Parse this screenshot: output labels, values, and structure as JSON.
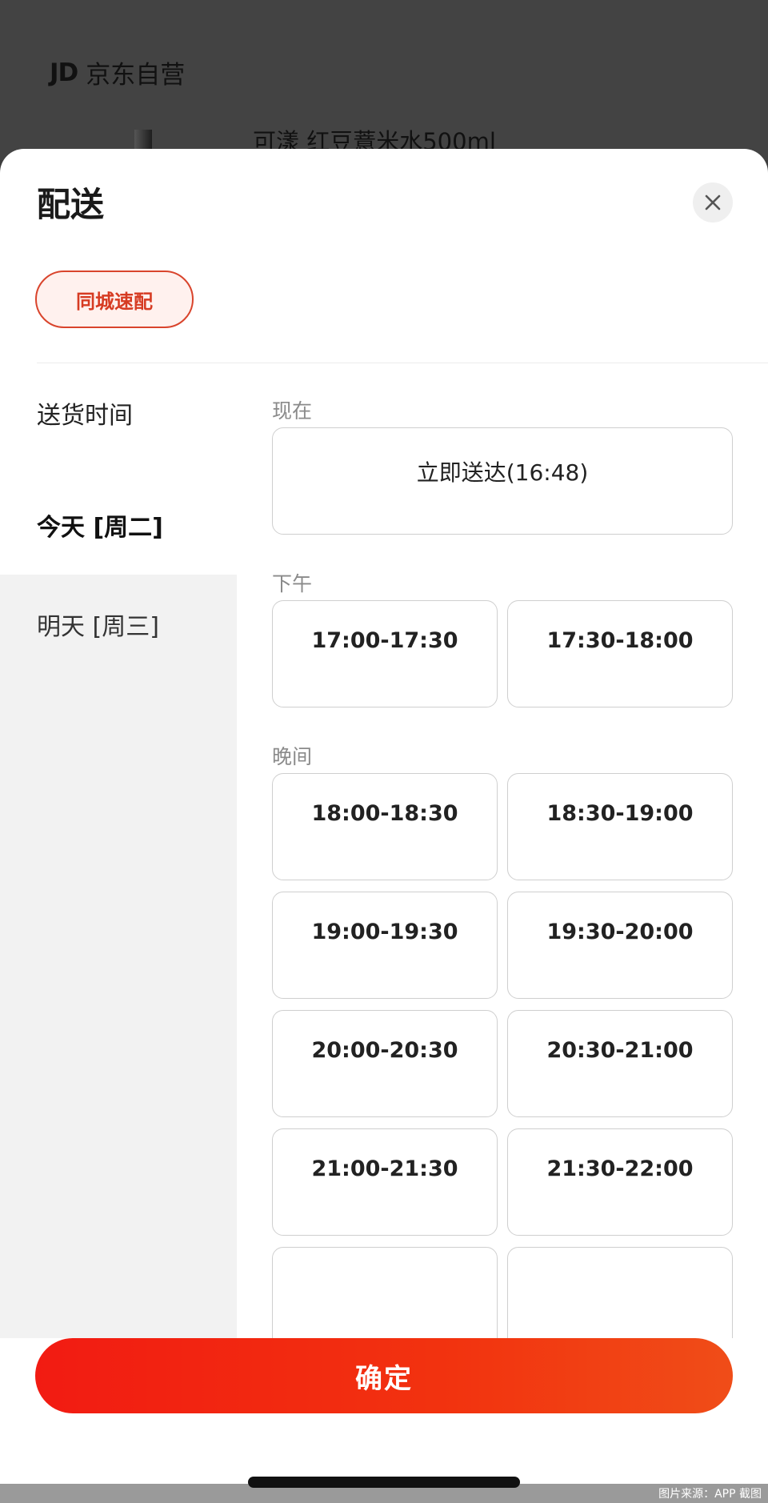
{
  "background": {
    "shop_logo": "JD",
    "shop_name": "京东自营",
    "product_name": "可漾 红豆薏米水500ml"
  },
  "sheet": {
    "title": "配送",
    "close_icon": "close-icon",
    "delivery_method": "同城速配"
  },
  "date_column": {
    "header": "送货时间",
    "dates": [
      {
        "label": "今天 [周二]",
        "selected": true
      },
      {
        "label": "明天 [周三]",
        "selected": false
      }
    ]
  },
  "slots": {
    "now": {
      "label": "现在",
      "items": [
        "立即送达(16:48)"
      ]
    },
    "afternoon": {
      "label": "下午",
      "items": [
        "17:00-17:30",
        "17:30-18:00"
      ]
    },
    "evening": {
      "label": "晚间",
      "items": [
        "18:00-18:30",
        "18:30-19:00",
        "19:00-19:30",
        "19:30-20:00",
        "20:00-20:30",
        "20:30-21:00",
        "21:00-21:30",
        "21:30-22:00"
      ]
    }
  },
  "footer": {
    "confirm_label": "确定"
  },
  "source_note": "图片来源：APP 截图",
  "colors": {
    "accent": "#e8361a",
    "chip_bg": "#fff1ee",
    "panel_gray": "#f2f2f2"
  }
}
